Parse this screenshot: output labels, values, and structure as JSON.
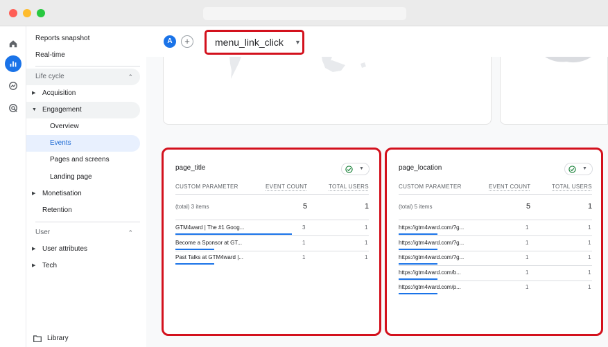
{
  "rail": {
    "icons": [
      "home-icon",
      "reports-icon",
      "explore-icon",
      "advertising-icon"
    ]
  },
  "sidebar": {
    "reports_snapshot": "Reports snapshot",
    "realtime": "Real-time",
    "lifecycle": "Life cycle",
    "acquisition": "Acquisition",
    "engagement": "Engagement",
    "overview": "Overview",
    "events": "Events",
    "pages_and_screens": "Pages and screens",
    "landing_page": "Landing page",
    "monetisation": "Monetisation",
    "retention": "Retention",
    "user": "User",
    "user_attributes": "User attributes",
    "tech": "Tech",
    "library": "Library"
  },
  "topbar": {
    "avatar": "A",
    "add": "+",
    "event_name": "menu_link_click"
  },
  "page_title_card": {
    "title": "page_title",
    "columns": [
      "CUSTOM PARAMETER",
      "EVENT COUNT",
      "TOTAL USERS"
    ],
    "total_label": "(total) 3 items",
    "total_event_count": "5",
    "total_users": "1",
    "rows": [
      {
        "name": "GTM4ward | The #1 Goog...",
        "event_count": "3",
        "users": "1",
        "share": 0.6
      },
      {
        "name": "Become a Sponsor at GT...",
        "event_count": "1",
        "users": "1",
        "share": 0.2
      },
      {
        "name": "Past Talks at GTM4ward |...",
        "event_count": "1",
        "users": "1",
        "share": 0.2
      }
    ]
  },
  "page_location_card": {
    "title": "page_location",
    "columns": [
      "CUSTOM PARAMETER",
      "EVENT COUNT",
      "TOTAL USERS"
    ],
    "total_label": "(total) 5 items",
    "total_event_count": "5",
    "total_users": "1",
    "rows": [
      {
        "name": "https://gtm4ward.com/?g...",
        "event_count": "1",
        "users": "1",
        "share": 0.2
      },
      {
        "name": "https://gtm4ward.com/?g...",
        "event_count": "1",
        "users": "1",
        "share": 0.2
      },
      {
        "name": "https://gtm4ward.com/?g...",
        "event_count": "1",
        "users": "1",
        "share": 0.2
      },
      {
        "name": "https://gtm4ward.com/b...",
        "event_count": "1",
        "users": "1",
        "share": 0.2
      },
      {
        "name": "https://gtm4ward.com/p...",
        "event_count": "1",
        "users": "1",
        "share": 0.2
      }
    ]
  },
  "colors": {
    "accent": "#1a73e8",
    "highlight_border": "#d3111d",
    "check": "#188038"
  }
}
